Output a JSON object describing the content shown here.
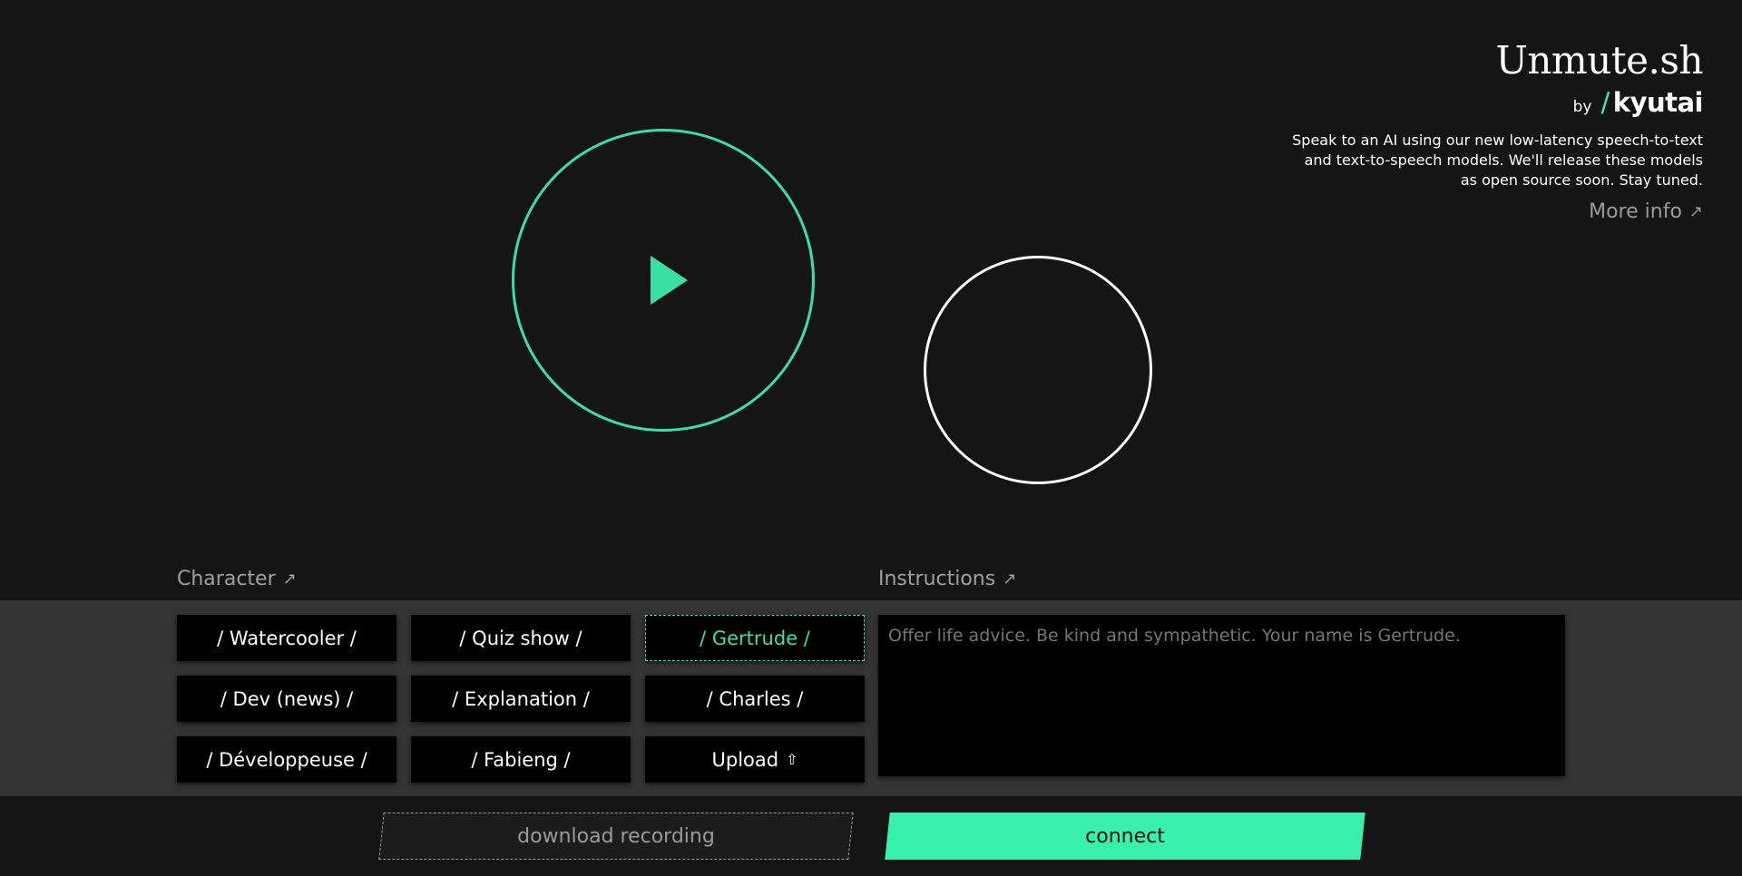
{
  "brand": {
    "title": "Unmute.sh",
    "by": "by",
    "slash": "/",
    "org": "kyutai",
    "description": "Speak to an AI using our new low-latency speech-to-text and text-to-speech models. We'll release these models as open source soon. Stay tuned.",
    "more_info": "More info"
  },
  "sections": {
    "character": "Character",
    "instructions": "Instructions"
  },
  "characters": [
    {
      "label": "/ Watercooler /",
      "selected": false
    },
    {
      "label": "/ Quiz show /",
      "selected": false
    },
    {
      "label": "/ Gertrude /",
      "selected": true
    },
    {
      "label": "/ Dev (news) /",
      "selected": false
    },
    {
      "label": "/ Explanation /",
      "selected": false
    },
    {
      "label": "/ Charles /",
      "selected": false
    },
    {
      "label": "/ Développeuse /",
      "selected": false
    },
    {
      "label": "/ Fabieng /",
      "selected": false
    },
    {
      "label": "Upload",
      "selected": false
    }
  ],
  "instructions": {
    "placeholder": "Offer life advice. Be kind and sympathetic. Your name is Gertrude."
  },
  "actions": {
    "download": "download recording",
    "connect": "connect"
  },
  "icons": {
    "arrow": "↗",
    "upload": "⇧"
  },
  "colors": {
    "accent": "#39f0ac",
    "background": "#151515",
    "panel": "#343434"
  }
}
